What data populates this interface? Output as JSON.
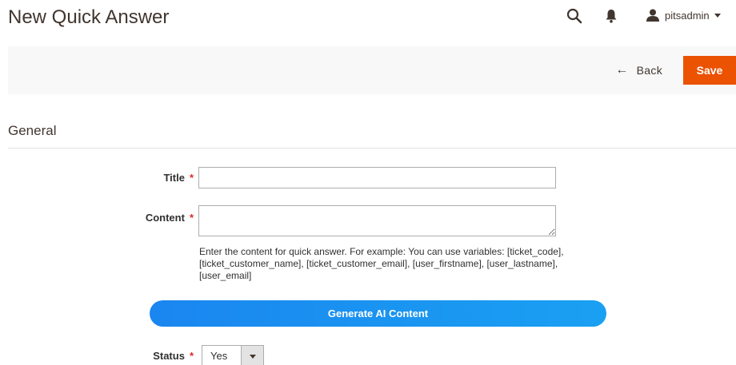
{
  "page": {
    "title": "New Quick Answer"
  },
  "header": {
    "search_icon": "search-icon",
    "notifications_icon": "bell-icon",
    "user": {
      "icon": "user-icon",
      "name": "pitsadmin"
    }
  },
  "actions": {
    "back_label": "Back",
    "save_label": "Save",
    "save_color": "#eb5202"
  },
  "section": {
    "title": "General"
  },
  "form": {
    "title": {
      "label": "Title",
      "required_mark": "*",
      "value": ""
    },
    "content": {
      "label": "Content",
      "required_mark": "*",
      "value": "",
      "note": "Enter the content for quick answer. For example: You can use variables: [ticket_code], [ticket_customer_name], [ticket_customer_email], [user_firstname], [user_lastname], [user_email]"
    },
    "generate_ai_label": "Generate AI Content",
    "status": {
      "label": "Status",
      "required_mark": "*",
      "selected": "Yes"
    }
  }
}
